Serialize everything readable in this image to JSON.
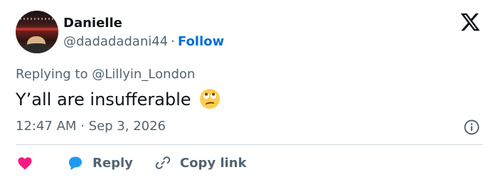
{
  "author": {
    "name": "Danielle",
    "handle": "@dadadadani44",
    "separator": "·",
    "follow_label": "Follow"
  },
  "reply_context": {
    "prefix": "Replying to",
    "mention": "@Lillyin_London"
  },
  "tweet": {
    "text": "Y’all are insufferable",
    "emoji": "eye-roll-emoji"
  },
  "timestamp": {
    "time": "12:47 AM",
    "separator": "·",
    "date": "Sep 3, 2026"
  },
  "actions": {
    "like_icon": "heart-icon",
    "reply_label": "Reply",
    "copy_link_label": "Copy link"
  },
  "icons": {
    "brand": "x-logo-icon",
    "info": "info-icon"
  },
  "colors": {
    "accent": "#006fd6",
    "like": "#f91880",
    "reply_icon": "#1d9bf0",
    "secondary_text": "#536471",
    "text": "#0f1419"
  }
}
